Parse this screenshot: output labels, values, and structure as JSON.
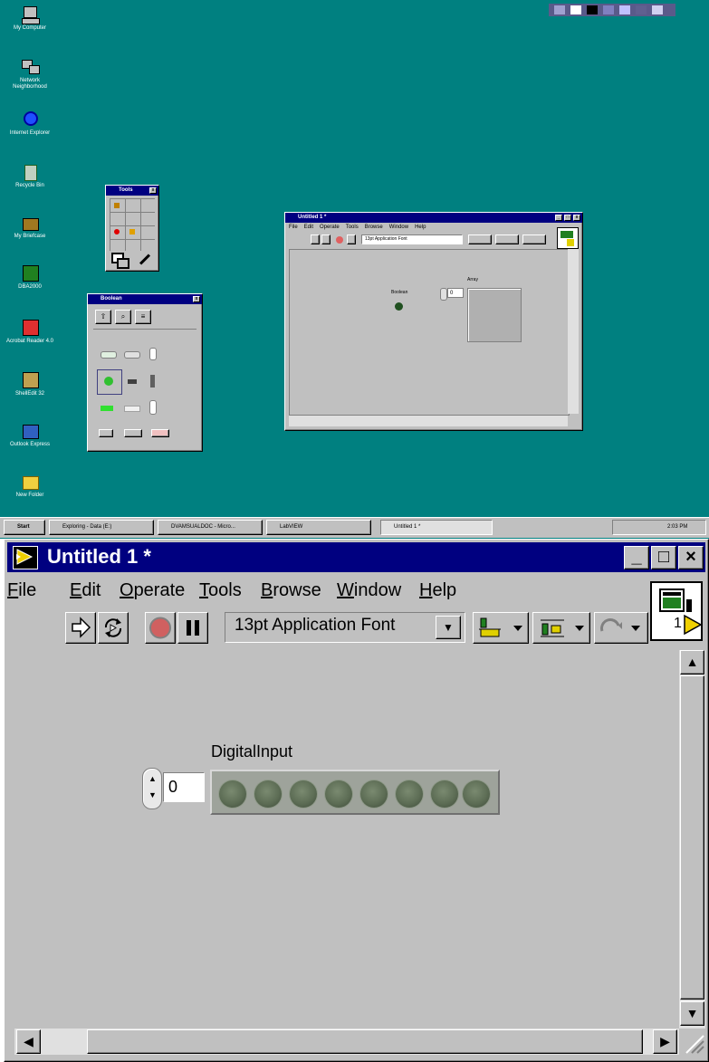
{
  "desktop": {
    "icons": [
      {
        "name": "my-computer-icon",
        "label": "My Computer"
      },
      {
        "name": "network-neighborhood-icon",
        "label": "Network Neighborhood"
      },
      {
        "name": "internet-explorer-icon",
        "label": "Internet Explorer"
      },
      {
        "name": "recycle-bin-icon",
        "label": "Recycle Bin"
      },
      {
        "name": "my-briefcase-icon",
        "label": "My Briefcase"
      },
      {
        "name": "dba-icon",
        "label": "DBA2000"
      },
      {
        "name": "acrobat-reader-icon",
        "label": "Acrobat Reader 4.0"
      },
      {
        "name": "shell-icon",
        "label": "ShellEdit 32"
      },
      {
        "name": "outlook-express-icon",
        "label": "Outlook Express"
      },
      {
        "name": "new-folder-icon",
        "label": "New Folder"
      }
    ],
    "tools_palette_title": "Tools",
    "controls_palette_title": "Boolean",
    "small_window": {
      "title": "Untitled 1 *",
      "menu": [
        "File",
        "Edit",
        "Operate",
        "Tools",
        "Browse",
        "Window",
        "Help"
      ],
      "font": "13pt Application Font",
      "boolean_label": "Boolean",
      "array_label": "Array",
      "index_value": "0"
    },
    "taskbar": {
      "start": "Start",
      "items": [
        "Exploring - Data (E:)",
        "DVAMSUALDOC - Micro...",
        "LabVIEW",
        "Untitled 1 *"
      ],
      "clock": "2:03 PM"
    }
  },
  "window": {
    "title": "Untitled 1 *",
    "controls": {
      "minimize": "_",
      "maximize": "□",
      "close": "×"
    },
    "menu": [
      "File",
      "Edit",
      "Operate",
      "Tools",
      "Browse",
      "Window",
      "Help"
    ],
    "menu_underline": [
      "F",
      "E",
      "O",
      "T",
      "B",
      "W",
      "H"
    ],
    "font_ring": "13pt Application Font",
    "connector_number": "1"
  },
  "panel": {
    "array_label": "DigitalInput",
    "index_value": "0",
    "led_count": 8
  }
}
